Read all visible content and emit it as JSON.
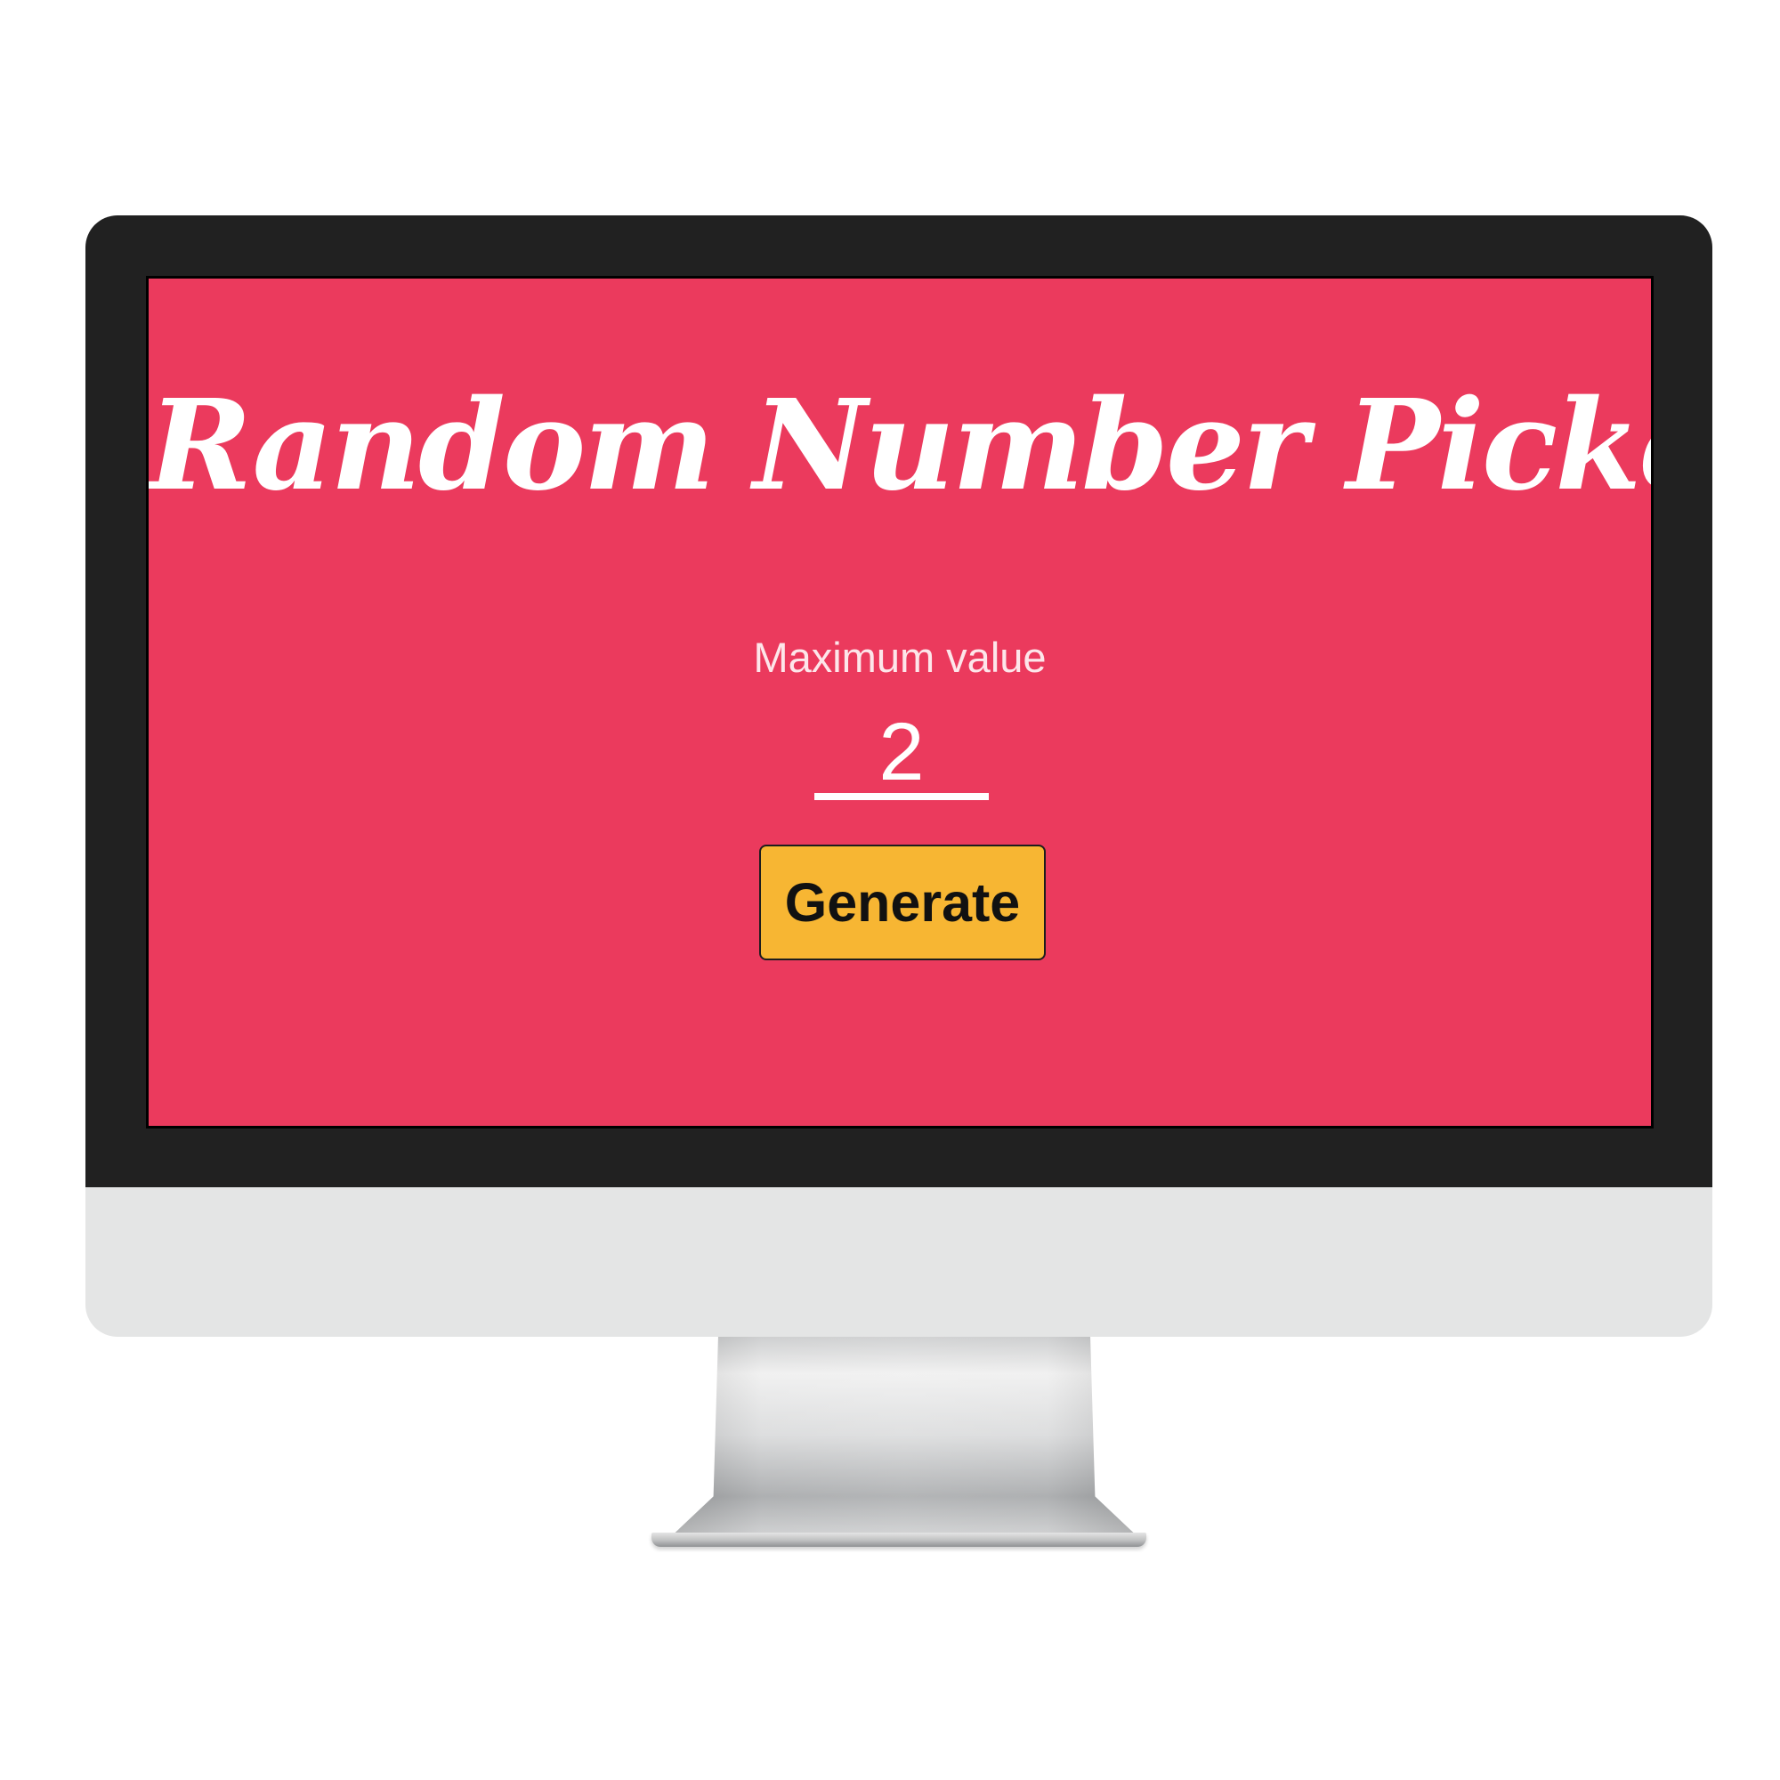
{
  "app": {
    "title": "Random Number Picker"
  },
  "form": {
    "max_label": "Maximum value",
    "max_value": "2",
    "generate_label": "Generate"
  },
  "colors": {
    "screen_background": "#eb3a5d",
    "button_background": "#f7b633",
    "bezel": "#212121",
    "chin": "#e4e5e5"
  }
}
